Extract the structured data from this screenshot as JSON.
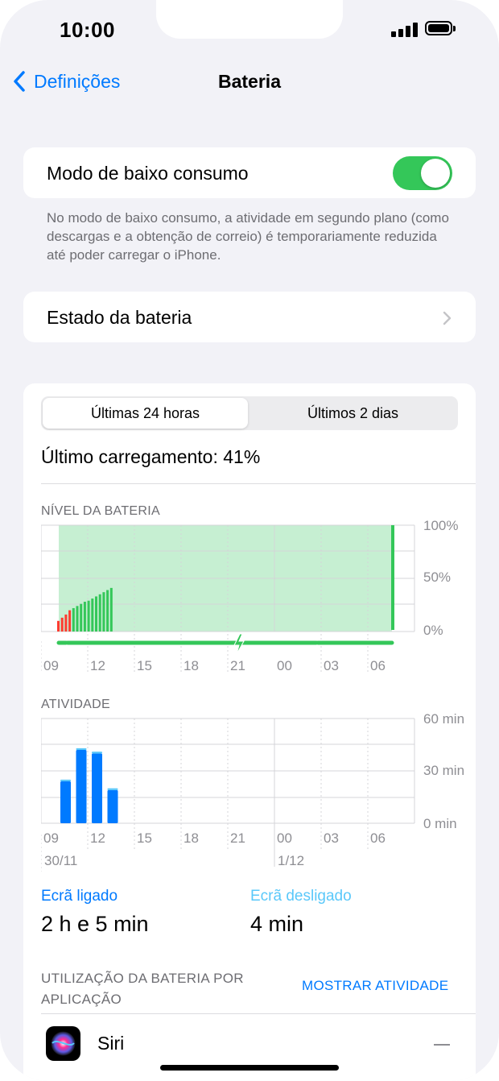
{
  "status_bar": {
    "time": "10:00"
  },
  "nav": {
    "back_label": "Definições",
    "title": "Bateria"
  },
  "low_power": {
    "label": "Modo de baixo consumo",
    "enabled": true,
    "footnote": "No modo de baixo consumo, a atividade em segundo plano (como descargas e a obtenção de correio) é temporariamente reduzida até poder carregar o iPhone."
  },
  "battery_health": {
    "label": "Estado da bateria"
  },
  "usage": {
    "tabs": [
      {
        "label": "Últimas 24 horas",
        "selected": true
      },
      {
        "label": "Últimos 2 dias",
        "selected": false
      }
    ],
    "last_charge": "Último carregamento: 41%",
    "level_section_label": "NÍVEL DA BATERIA",
    "activity_section_label": "ATIVIDADE",
    "screen_on_label": "Ecrã ligado",
    "screen_on_value": "2 h e 5 min",
    "screen_off_label": "Ecrã desligado",
    "screen_off_value": "4 min",
    "by_app_label": "UTILIZAÇÃO DA BATERIA POR APLICAÇÃO",
    "show_activity": "MOSTRAR ATIVIDADE",
    "apps": [
      {
        "name": "Siri",
        "value": "—"
      }
    ]
  },
  "colors": {
    "accent": "#007aff",
    "toggle_on": "#34c759",
    "battery_green": "#34c759",
    "battery_low": "#ff3b30",
    "charging_fill": "#c6efd2",
    "screen_on": "#007aff",
    "screen_off": "#5ac8fa"
  },
  "chart_data": [
    {
      "type": "bar",
      "title": "NÍVEL DA BATERIA",
      "x_tick_labels": [
        "09",
        "12",
        "15",
        "18",
        "21",
        "00",
        "03",
        "06"
      ],
      "y_tick_labels": [
        "100%",
        "50%",
        "0%"
      ],
      "ylim": [
        0,
        100
      ],
      "grid": true,
      "series": [
        {
          "values": [
            10,
            13,
            16,
            20,
            22,
            24,
            26,
            28,
            29,
            31,
            33,
            35,
            37,
            39,
            41
          ],
          "low_threshold": 20
        }
      ],
      "charging_segment": {
        "start_hour_offset": 0.2,
        "end_hour_offset": 24,
        "level_end": 100
      }
    },
    {
      "type": "bar",
      "title": "ATIVIDADE",
      "x_tick_labels": [
        "09",
        "12",
        "15",
        "18",
        "21",
        "00",
        "03",
        "06"
      ],
      "date_labels": [
        "30/11",
        "1/12"
      ],
      "y_tick_labels": [
        "60 min",
        "30 min",
        "0 min"
      ],
      "ylim": [
        0,
        60
      ],
      "grid": true,
      "series": [
        {
          "name": "Ecrã ligado",
          "values": [
            24,
            42,
            40,
            19
          ]
        },
        {
          "name": "Ecrã desligado",
          "values": [
            1,
            1,
            1,
            1
          ]
        }
      ]
    }
  ]
}
